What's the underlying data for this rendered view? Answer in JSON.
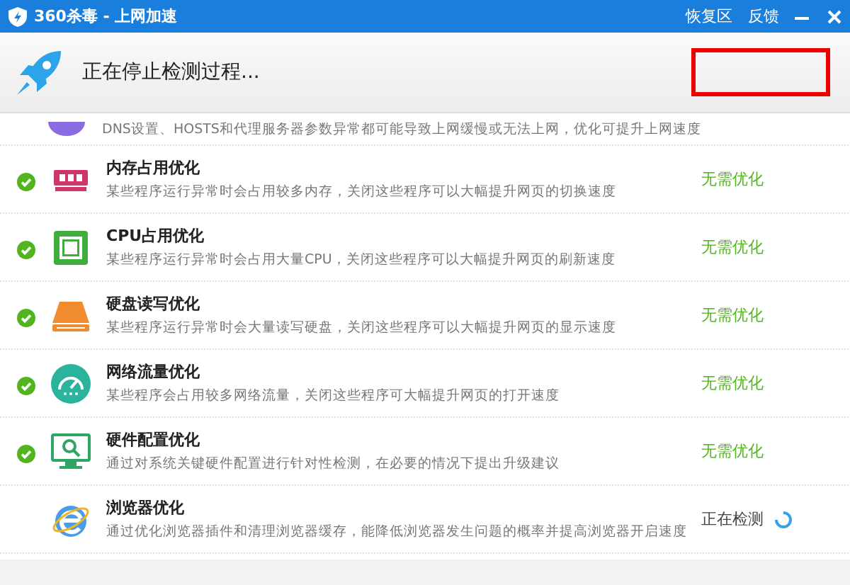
{
  "window": {
    "title": "360杀毒 - 上网加速",
    "links": [
      "恢复区",
      "反馈"
    ]
  },
  "header": {
    "status": "正在停止检测过程..."
  },
  "partial_row": {
    "description": "DNS设置、HOSTS和代理服务器参数异常都可能导致上网缓慢或无法上网，优化可提升上网速度"
  },
  "items": [
    {
      "kind": "memory",
      "title": "内存占用优化",
      "description": "某些程序运行异常时会占用较多内存，关闭这些程序可以大幅提升网页的切换速度",
      "checked": true,
      "status": "无需优化"
    },
    {
      "kind": "cpu",
      "title": "CPU占用优化",
      "description": "某些程序运行异常时会占用大量CPU，关闭这些程序可以大幅提升网页的刷新速度",
      "checked": true,
      "status": "无需优化"
    },
    {
      "kind": "disk",
      "title": "硬盘读写优化",
      "description": "某些程序运行异常时会大量读写硬盘，关闭这些程序可以大幅提升网页的显示速度",
      "checked": true,
      "status": "无需优化"
    },
    {
      "kind": "gauge",
      "title": "网络流量优化",
      "description": "某些程序会占用较多网络流量，关闭这些程序可大幅提升网页的打开速度",
      "checked": true,
      "status": "无需优化"
    },
    {
      "kind": "monitor",
      "title": "硬件配置优化",
      "description": "通过对系统关键硬件配置进行针对性检测，在必要的情况下提出升级建议",
      "checked": true,
      "status": "无需优化"
    },
    {
      "kind": "browser",
      "title": "浏览器优化",
      "description": "通过优化浏览器插件和清理浏览器缓存，能降低浏览器发生问题的概率并提高浏览器开启速度",
      "checked": false,
      "status": "正在检测"
    }
  ]
}
